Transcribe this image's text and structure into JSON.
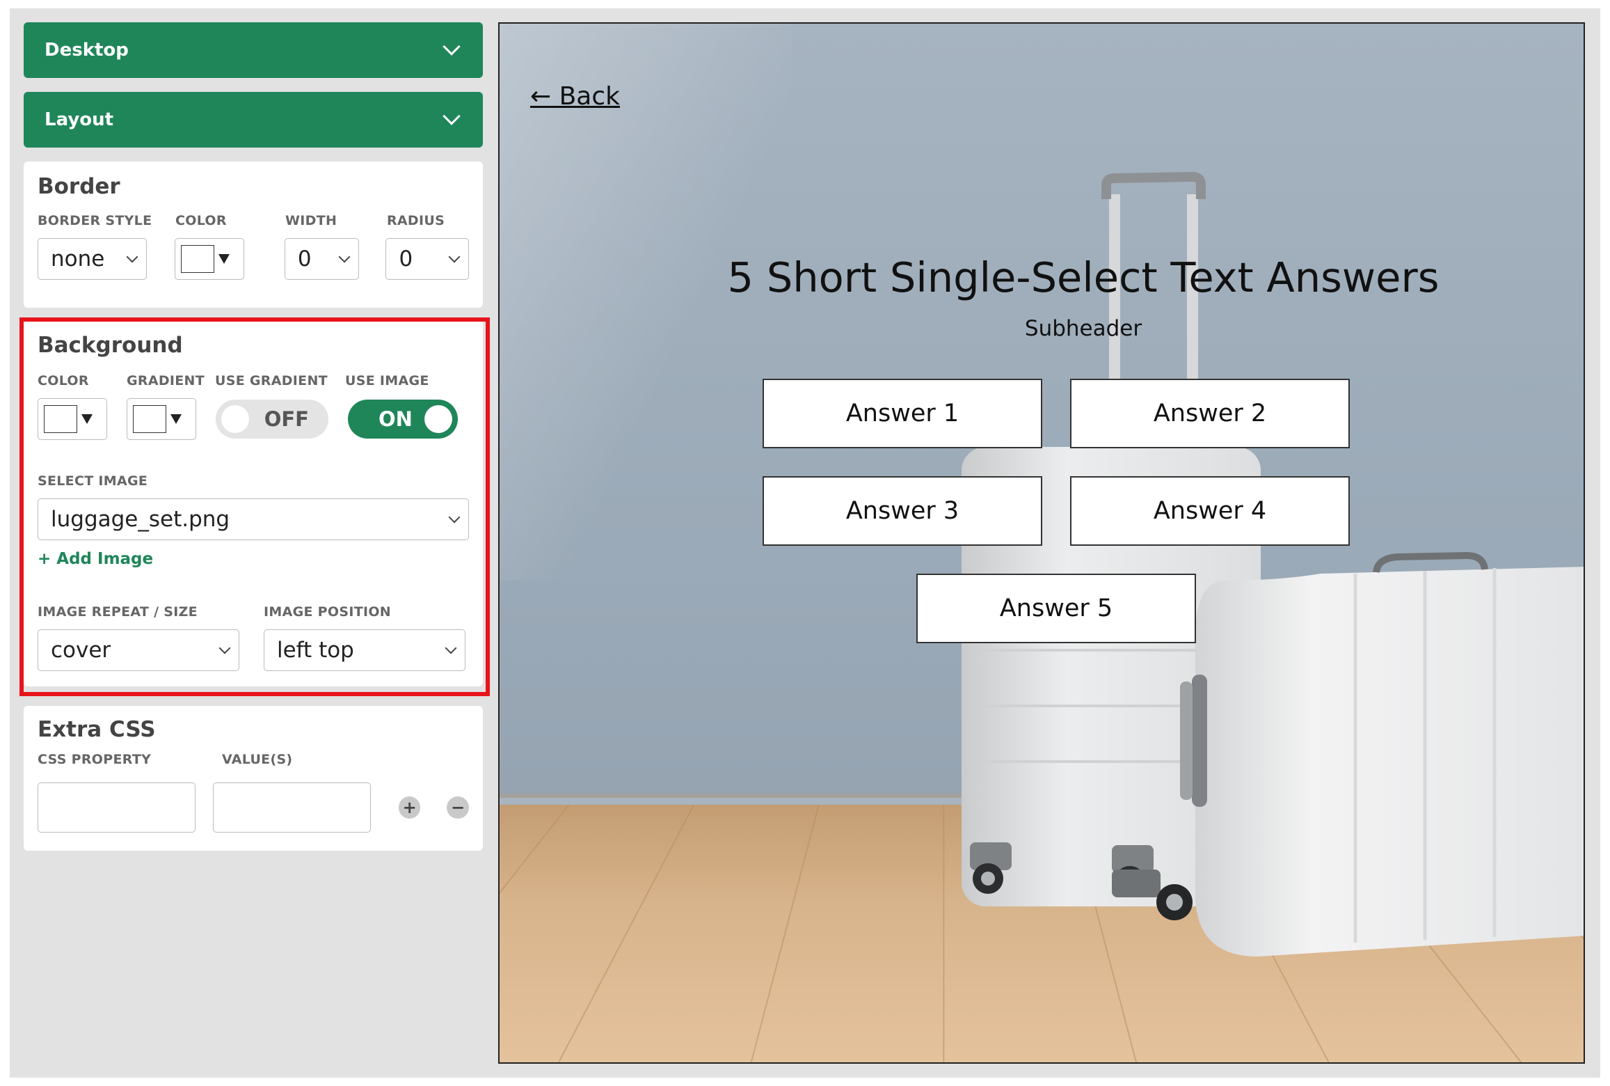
{
  "accordions": [
    {
      "label": "Desktop"
    },
    {
      "label": "Layout"
    }
  ],
  "border": {
    "title": "Border",
    "labels": {
      "style": "BORDER STYLE",
      "color": "COLOR",
      "width": "WIDTH",
      "radius": "RADIUS"
    },
    "style_value": "none",
    "width_value": "0",
    "radius_value": "0"
  },
  "background": {
    "title": "Background",
    "labels": {
      "color": "COLOR",
      "gradient": "GRADIENT",
      "use_gradient": "USE GRADIENT",
      "use_image": "USE IMAGE"
    },
    "use_gradient": "OFF",
    "use_image": "ON",
    "select_image_label": "SELECT IMAGE",
    "select_image_value": "luggage_set.png",
    "add_image": "+ Add Image",
    "repeat_label": "IMAGE REPEAT / SIZE",
    "repeat_value": "cover",
    "position_label": "IMAGE POSITION",
    "position_value": "left top",
    "highlight_color": "#e8141c"
  },
  "extra_css": {
    "title": "Extra CSS",
    "property_label": "CSS PROPERTY",
    "values_label": "VALUE(S)",
    "add": "+",
    "remove": "−"
  },
  "preview": {
    "back": "← Back",
    "title": "5 Short Single-Select Text Answers",
    "subheader": "Subheader",
    "answers": [
      "Answer 1",
      "Answer 2",
      "Answer 3",
      "Answer 4",
      "Answer 5"
    ]
  },
  "colors": {
    "accent": "#1f865a",
    "frame": "#e2e2e2"
  }
}
